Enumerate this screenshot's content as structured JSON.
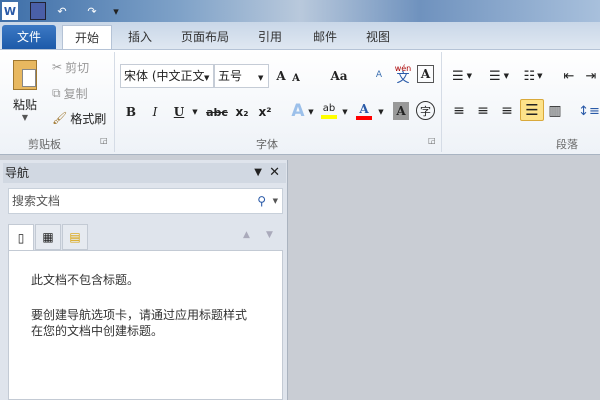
{
  "quick_access": {
    "app_icon": "word-icon",
    "save": "save-icon",
    "undo": "undo-icon",
    "redo": "redo-icon",
    "customize": "customize-qat-icon"
  },
  "tabs": [
    "文件",
    "开始",
    "插入",
    "页面布局",
    "引用",
    "邮件",
    "视图"
  ],
  "ribbon": {
    "clipboard": {
      "paste": "粘贴",
      "cut": "剪切",
      "copy": "复制",
      "format_painter": "格式刷",
      "label": "剪贴板"
    },
    "font": {
      "font_name": "宋体 (中文正文",
      "font_size": "五号",
      "grow": "A",
      "shrink": "A",
      "change_case": "Aa",
      "clear": "A",
      "pinyin": "wén",
      "pinyin_char": "文",
      "border": "A",
      "bold": "B",
      "italic": "I",
      "underline": "U",
      "strike": "abc",
      "subscript": "x₂",
      "superscript": "x²",
      "effects": "A",
      "highlight": "ab",
      "font_color": "A",
      "shading": "A",
      "enclose": "字",
      "label": "字体"
    },
    "paragraph": {
      "label": "段落"
    }
  },
  "colors": {
    "highlight": "#ffff00",
    "font_color": "#ff0000",
    "file_tab": "#2a66b5"
  },
  "nav": {
    "title": "导航",
    "search_placeholder": "搜索文档",
    "msg1": "此文档不包含标题。",
    "msg2": "要创建导航选项卡，请通过应用标题样式",
    "msg3": "在您的文档中创建标题。"
  }
}
